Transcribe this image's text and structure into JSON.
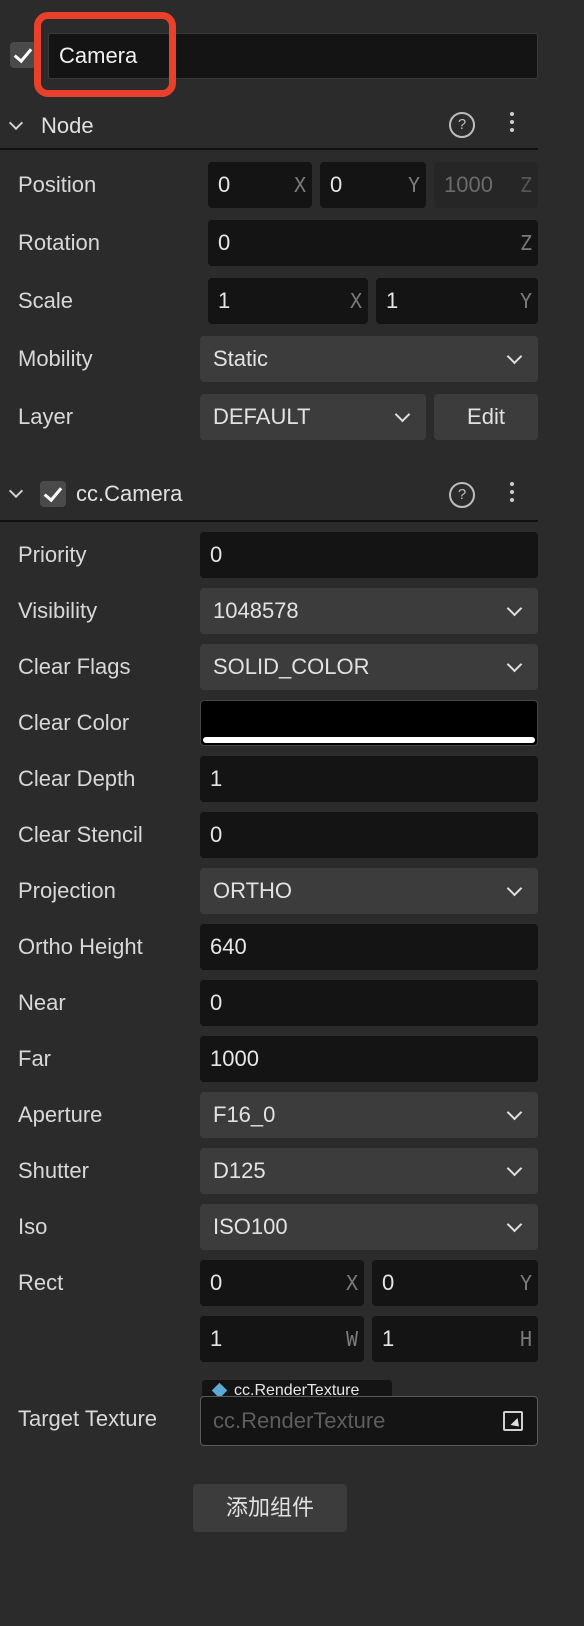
{
  "header": {
    "name_value": "Camera"
  },
  "node": {
    "title": "Node",
    "position": {
      "label": "Position",
      "x": "0",
      "y": "0",
      "z": "1000"
    },
    "rotation": {
      "label": "Rotation",
      "z": "0"
    },
    "scale": {
      "label": "Scale",
      "x": "1",
      "y": "1"
    },
    "mobility": {
      "label": "Mobility",
      "value": "Static"
    },
    "layer": {
      "label": "Layer",
      "value": "DEFAULT",
      "edit": "Edit"
    }
  },
  "axis": {
    "x": "X",
    "y": "Y",
    "z": "Z",
    "w": "W",
    "h": "H"
  },
  "camera": {
    "title": "cc.Camera",
    "priority": {
      "label": "Priority",
      "value": "0"
    },
    "visibility": {
      "label": "Visibility",
      "value": "1048578"
    },
    "clear_flags": {
      "label": "Clear Flags",
      "value": "SOLID_COLOR"
    },
    "clear_color": {
      "label": "Clear Color",
      "swatch": "#000000"
    },
    "clear_depth": {
      "label": "Clear Depth",
      "value": "1"
    },
    "clear_stencil": {
      "label": "Clear Stencil",
      "value": "0"
    },
    "projection": {
      "label": "Projection",
      "value": "ORTHO"
    },
    "ortho_height": {
      "label": "Ortho Height",
      "value": "640"
    },
    "near": {
      "label": "Near",
      "value": "0"
    },
    "far": {
      "label": "Far",
      "value": "1000"
    },
    "aperture": {
      "label": "Aperture",
      "value": "F16_0"
    },
    "shutter": {
      "label": "Shutter",
      "value": "D125"
    },
    "iso": {
      "label": "Iso",
      "value": "ISO100"
    },
    "rect": {
      "label": "Rect",
      "x": "0",
      "y": "0",
      "w": "1",
      "h": "1"
    },
    "target_texture": {
      "label": "Target Texture",
      "tag": "cc.RenderTexture",
      "placeholder": "cc.RenderTexture"
    }
  },
  "footer": {
    "add_component": "添加组件"
  },
  "colors": {
    "highlight": "#e8402a",
    "asset_diamond": "#5aa9d6"
  }
}
